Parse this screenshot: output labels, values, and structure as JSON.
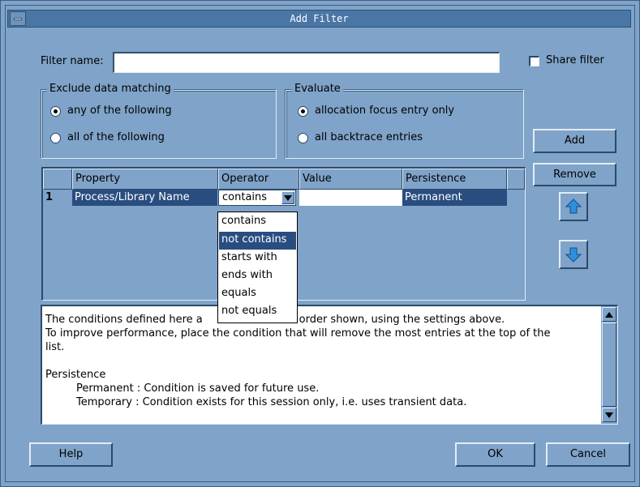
{
  "window": {
    "title": "Add Filter"
  },
  "filter": {
    "name_label": "Filter name:",
    "name_value": "",
    "share_label": "Share filter",
    "share_checked": false
  },
  "exclude_group": {
    "title": "Exclude data matching",
    "options": [
      {
        "label": "any of the following",
        "selected": true
      },
      {
        "label": "all of the following",
        "selected": false
      }
    ]
  },
  "evaluate_group": {
    "title": "Evaluate",
    "options": [
      {
        "label": "allocation focus entry only",
        "selected": true
      },
      {
        "label": "all backtrace entries",
        "selected": false
      }
    ]
  },
  "buttons": {
    "add": "Add",
    "remove": "Remove",
    "help": "Help",
    "ok": "OK",
    "cancel": "Cancel"
  },
  "icons": {
    "up": "arrow-up-icon",
    "down": "arrow-down-icon",
    "accent": "#2f8fdc"
  },
  "table": {
    "columns": [
      "Property",
      "Operator",
      "Value",
      "Persistence"
    ],
    "rows": [
      {
        "index": "1",
        "property": "Process/Library Name",
        "operator": "contains",
        "value": "",
        "persistence": "Permanent"
      }
    ]
  },
  "operator_dropdown": {
    "options": [
      "contains",
      "not contains",
      "starts with",
      "ends with",
      "equals",
      "not equals"
    ],
    "highlighted": "not contains"
  },
  "description": {
    "lines": [
      "The conditions defined here a",
      "n the order shown, using the settings above.",
      "To improve performance, place the condition that will remove the most entries at the top of the",
      "list.",
      "",
      "Persistence",
      "Permanent : Condition is saved for future use.",
      "Temporary : Condition exists for this session only, i.e. uses transient data."
    ]
  }
}
